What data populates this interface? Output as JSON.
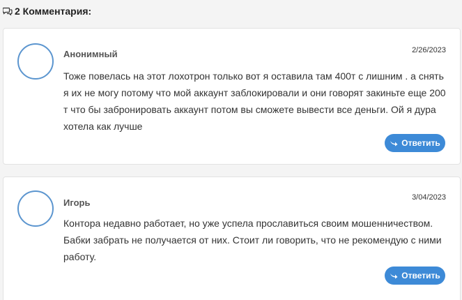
{
  "comments_section": {
    "header_title": "2 Комментария:",
    "header_icon": "comments-icon",
    "accent_color": "#3d8ad7",
    "comments": [
      {
        "author": "Анонимный",
        "date": "2/26/2023",
        "text": "Тоже повелась на этот лохотрон только вот я оставила там 400т с лишним . а снять я их не могу потому что мой аккаунт заблокировали и они говорят закиньте еще 200 т что бы забронировать аккаунт потом вы сможете вывести все деньги. Ой я дура хотела как лучше",
        "reply_label": "Ответить",
        "reply_icon": "reply-arrow-icon"
      },
      {
        "author": "Игорь",
        "date": "3/04/2023",
        "text": "Контора недавно работает, но уже успела прославиться своим мошенничеством. Бабки забрать не получается от них. Стоит ли говорить, что не рекомендую с ними работу.",
        "reply_label": "Ответить",
        "reply_icon": "reply-arrow-icon"
      }
    ]
  }
}
